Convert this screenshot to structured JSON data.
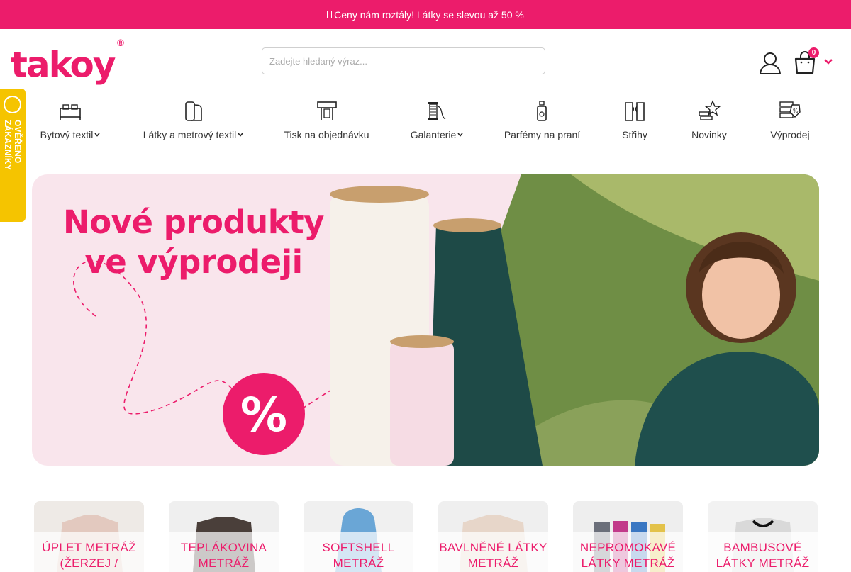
{
  "promo_bar": {
    "icon": "tag-icon",
    "text": "Ceny nám roztály! Látky se slevou až 50 %"
  },
  "header": {
    "logo": "takoy",
    "logo_mark": "®",
    "search": {
      "placeholder": "Zadejte hledaný výraz...",
      "value": ""
    },
    "account_icon": "user-icon",
    "cart": {
      "icon": "shopping-bag-icon",
      "count": "0"
    }
  },
  "side_badge": {
    "text": "OVĚŘENO ZÁKAZNÍKY",
    "color": "#f5c400"
  },
  "nav": {
    "items": [
      {
        "label": "Bytový textil",
        "icon": "bed-icon",
        "dropdown": true
      },
      {
        "label": "Látky a metrový textil",
        "icon": "fabric-roll-icon",
        "dropdown": true
      },
      {
        "label": "Tisk na objednávku",
        "icon": "printer-icon",
        "dropdown": false
      },
      {
        "label": "Galanterie",
        "icon": "thread-spool-icon",
        "dropdown": true
      },
      {
        "label": "Parfémy na praní",
        "icon": "perfume-bottle-icon",
        "dropdown": false
      },
      {
        "label": "Střihy",
        "icon": "pattern-icon",
        "dropdown": false
      },
      {
        "label": "Novinky",
        "icon": "new-star-icon",
        "dropdown": false
      },
      {
        "label": "Výprodej",
        "icon": "sale-tag-icon",
        "dropdown": false
      }
    ]
  },
  "hero": {
    "title_line1": "Nové produkty",
    "title_line2": "ve výprodeji",
    "badge": "%",
    "colors": {
      "accent": "#ec1c6b",
      "background": "#f9e5ec"
    }
  },
  "categories": [
    {
      "label_line1": "ÚPLET METRÁŽ",
      "label_line2": "(ŽERZEJ / JERSEY)"
    },
    {
      "label_line1": "TEPLÁKOVINA",
      "label_line2": "METRÁŽ"
    },
    {
      "label_line1": "SOFTSHELL",
      "label_line2": "METRÁŽ"
    },
    {
      "label_line1": "BAVLNĚNÉ LÁTKY",
      "label_line2": "METRÁŽ"
    },
    {
      "label_line1": "NEPROMOKAVÉ",
      "label_line2": "LÁTKY METRÁŽ"
    },
    {
      "label_line1": "BAMBUSOVÉ",
      "label_line2": "LÁTKY METRÁŽ"
    }
  ],
  "colors": {
    "brand": "#ec1c6b",
    "text": "#333333"
  }
}
